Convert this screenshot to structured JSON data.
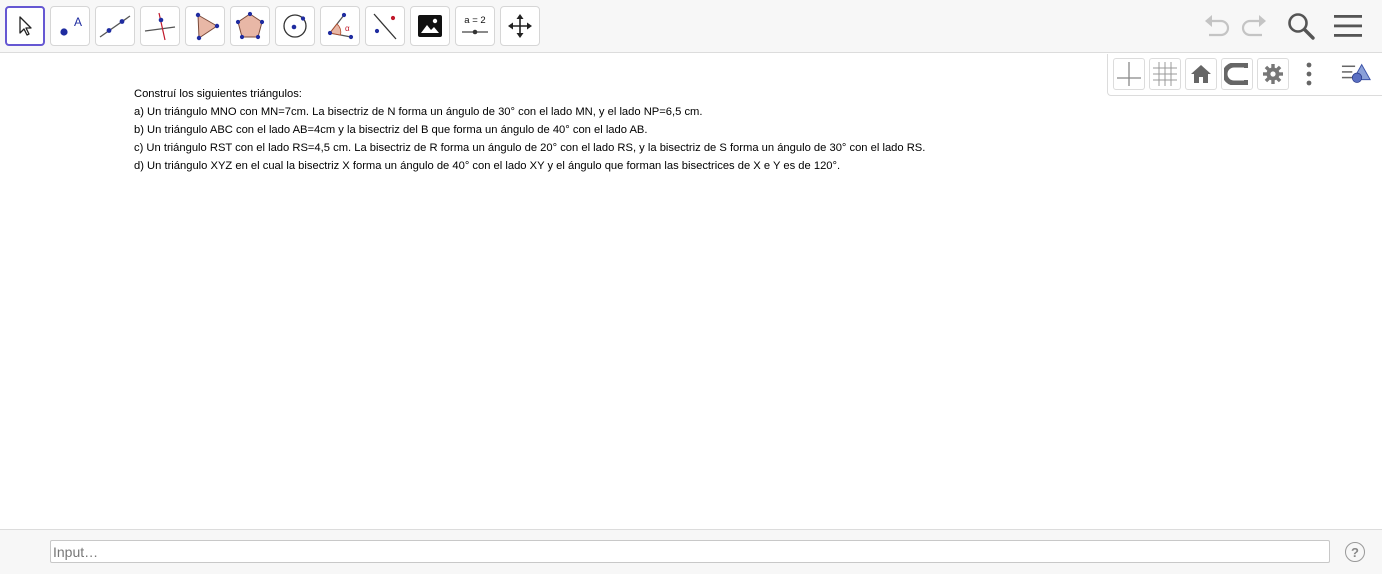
{
  "toolbar": {
    "tools": [
      {
        "name": "move-tool",
        "icon": "arrow-pointer-icon"
      },
      {
        "name": "point-tool",
        "icon": "point-label-icon",
        "label": "A"
      },
      {
        "name": "line-tool",
        "icon": "line-two-points-icon"
      },
      {
        "name": "perpendicular-line-tool",
        "icon": "perpendicular-line-icon"
      },
      {
        "name": "polygon-tool",
        "icon": "triangle-polygon-icon"
      },
      {
        "name": "regular-polygon-tool",
        "icon": "pentagon-icon"
      },
      {
        "name": "circle-tool",
        "icon": "circle-center-icon"
      },
      {
        "name": "angle-tool",
        "icon": "angle-icon",
        "label": "α"
      },
      {
        "name": "reflect-tool",
        "icon": "reflect-line-icon"
      },
      {
        "name": "image-tool",
        "icon": "image-icon"
      },
      {
        "name": "slider-tool",
        "icon": "slider-icon",
        "label": "a = 2"
      },
      {
        "name": "move-graphics-tool",
        "icon": "move-arrows-icon"
      }
    ],
    "right": [
      "undo-icon",
      "redo-icon",
      "search-icon",
      "menu-icon"
    ]
  },
  "stylebar": [
    "axes-icon",
    "grid-icon",
    "home-icon",
    "magnet-icon",
    "gear-icon",
    "more-vertical-icon",
    "toggle-stylebar-icon"
  ],
  "graphics": {
    "heading": "Construí los siguientes triángulos:",
    "tasks": [
      "a) Un triángulo MNO con MN=7cm. La bisectriz de N forma un ángulo de 30° con el lado MN, y el lado NP=6,5 cm.",
      "b) Un triángulo ABC con el lado AB=4cm y la bisectriz del B que forma un ángulo de 40° con el lado AB.",
      "c) Un triángulo RST con el lado RS=4,5 cm. La bisectriz de R forma un ángulo de 20° con el lado RS, y la bisectriz de S forma un ángulo de 30° con el lado RS.",
      "d) Un triángulo XYZ en el cual la bisectriz X forma un ángulo de 40° con el lado XY y el ángulo que forman las bisectrices de X e Y es de 120°."
    ]
  },
  "inputbar": {
    "placeholder": "Input…",
    "value": "",
    "help_label": "?"
  },
  "colors": {
    "active_tool_border": "#6557d2",
    "point_blue": "#1f2ca0",
    "polygon_fill": "#e8b7a6",
    "reflect_red": "#c0182a"
  }
}
